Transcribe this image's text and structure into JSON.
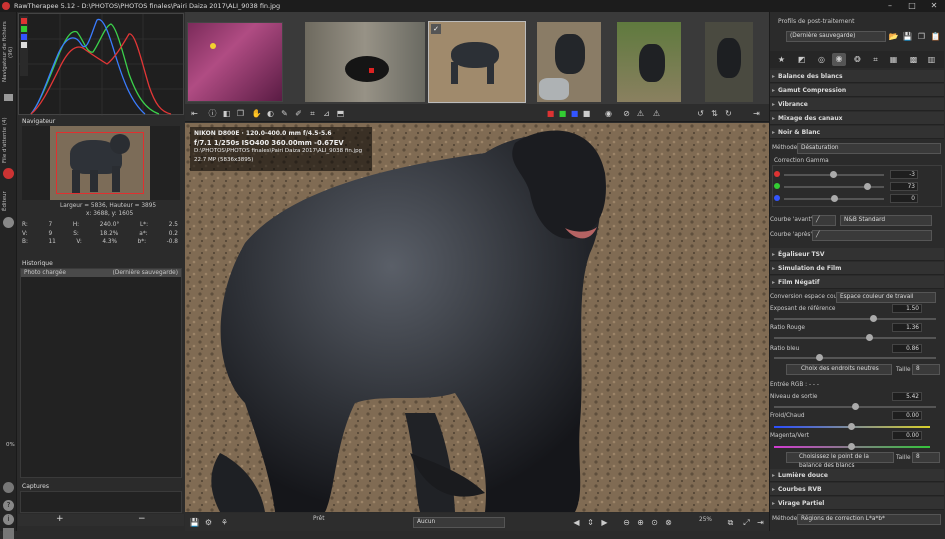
{
  "window": {
    "title": "RawTherapee 5.12 - D:\\PHOTOS\\PHOTOS finales\\Pairi Daiza 2017\\ALI_9038 fin.jpg",
    "min": "–",
    "max": "□",
    "close": "✕"
  },
  "vtabs": {
    "file_browser": "Navigateur de fichiers (96)",
    "queue": "File d'attente (4)",
    "editor": "Éditeur"
  },
  "navigator": {
    "title": "Navigateur",
    "size": "Largeur = 5836, Hauteur = 3895",
    "coords": "x: 3688, y: 1605",
    "readout": [
      [
        "R:",
        "7",
        "H:",
        "240.0°",
        "L*:",
        "2.5"
      ],
      [
        "V:",
        "9",
        "S:",
        "18.2%",
        "a*:",
        "0.2"
      ],
      [
        "B:",
        "11",
        "V:",
        "4.3%",
        "b*:",
        "-0.8"
      ]
    ]
  },
  "history": {
    "title": "Historique",
    "col1": "Photo chargée",
    "col2": "(Dernière sauvegarde)"
  },
  "captures": {
    "title": "Captures",
    "add": "+",
    "remove": "−"
  },
  "zoom_left": "0%",
  "info": {
    "line1": "NIKON D800E · 120.0-400.0 mm f/4.5-5.6",
    "line2": "f/7.1  1/250s  ISO400  360.00mm  -0.67EV",
    "line3": "D:\\PHOTOS\\PHOTOS finales\\Pairi Daiza 2017\\ALI_9038 fin.jpg",
    "line4": "22.7 MP (5836x3895)"
  },
  "bottombar": {
    "preview": "Prêt",
    "crop_ratio": "Aucun",
    "zoom": "25%"
  },
  "right": {
    "profile_title": "Profils de post-traitement",
    "profile_value": "(Dernière sauvegarde)",
    "sections": [
      "Balance des blancs",
      "Gamut Compression",
      "Vibrance",
      "Mixage des canaux",
      "Noir & Blanc"
    ],
    "methode_label": "Méthode",
    "methode_value": "Désaturation",
    "gamma_label": "Correction Gamma",
    "gamma_values": [
      "-3",
      "73",
      "0"
    ],
    "curve_before": "Courbe 'avant'",
    "curve_after": "Courbe 'après'",
    "curve_mode": "N&B Standard",
    "sections2": [
      "Égaliseur TSV",
      "Simulation de Film",
      "Film Négatif"
    ],
    "conv_label": "Conversion espace couleur",
    "conv_value": "Espace couleur de travail",
    "expo_label": "Exposant de référence",
    "expo_value": "1.50",
    "ratio_red_label": "Ratio Rouge",
    "ratio_red_value": "1.36",
    "ratio_blue_label": "Ratio bleu",
    "ratio_blue_value": "0.86",
    "pick_neutral": "Choix des endroits neutres",
    "size_label": "Taille",
    "size_value": "8",
    "input_rgb": "Entrée RGB : - - -",
    "output_level_label": "Niveau de sortie",
    "output_level_value": "5.42",
    "warm_label": "Froid/Chaud",
    "warm_value": "0.00",
    "magenta_label": "Magenta/Vert",
    "magenta_value": "0.00",
    "pick_wb": "Choisissez le point de la balance des blancs",
    "size2_value": "8",
    "sections3": [
      "Lumière douce",
      "Courbes RVB",
      "Virage Partiel"
    ],
    "bottom_method_label": "Méthode",
    "bottom_method_value": "Régions de correction L*a*b*"
  }
}
